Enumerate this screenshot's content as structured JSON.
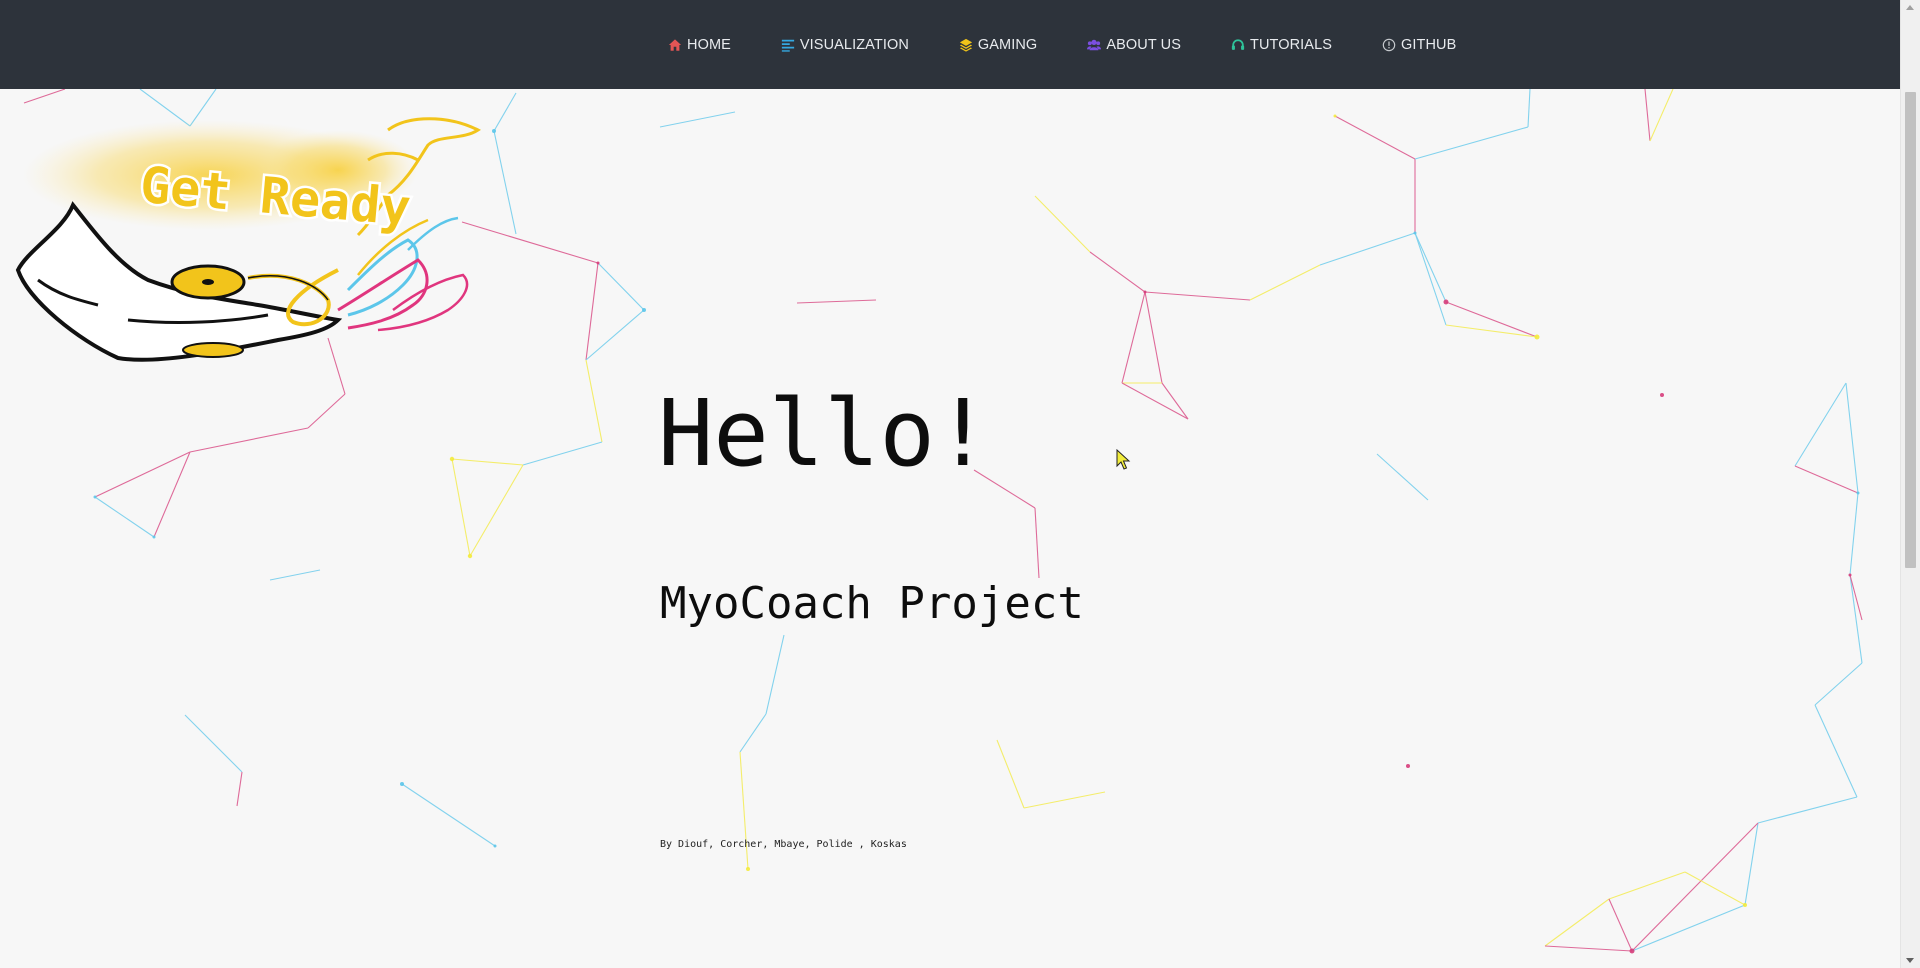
{
  "nav": {
    "items": [
      {
        "label": "HOME",
        "icon": "home-icon",
        "color": "#e25555"
      },
      {
        "label": "VISUALIZATION",
        "icon": "align-left-icon",
        "color": "#35a8e0"
      },
      {
        "label": "GAMING",
        "icon": "layers-icon",
        "color": "#f0c419"
      },
      {
        "label": "ABOUT US",
        "icon": "users-icon",
        "color": "#7b4fe0"
      },
      {
        "label": "TUTORIALS",
        "icon": "headset-icon",
        "color": "#2ec49a"
      },
      {
        "label": "GITHUB",
        "icon": "info-circle-icon",
        "color": "#c8ccd0"
      }
    ]
  },
  "logo": {
    "text": "Get Ready"
  },
  "hero": {
    "title": "Hello!",
    "subtitle": "MyoCoach Project",
    "credits": "By Diouf, Corcher, Mbaye, Polide , Koskas"
  },
  "colors": {
    "navbar": "#2d333b",
    "background": "#f7f7f7",
    "cyan": "#5cc6ea",
    "magenta": "#d63c7a",
    "yellow": "#f3ea3c"
  }
}
